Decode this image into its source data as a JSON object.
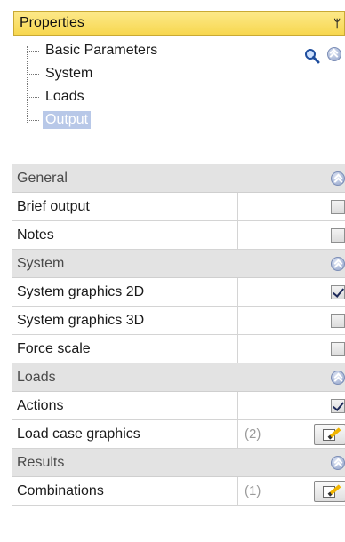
{
  "panel": {
    "title": "Properties"
  },
  "tree": {
    "items": [
      {
        "label": "Basic Parameters",
        "selected": false
      },
      {
        "label": "System",
        "selected": false
      },
      {
        "label": "Loads",
        "selected": false
      },
      {
        "label": "Output",
        "selected": true
      }
    ]
  },
  "icons": {
    "search": "search-icon",
    "collapse": "double-chevron-up-icon",
    "pin": "pin-icon",
    "edit": "edit-icon"
  },
  "sections": [
    {
      "title": "General",
      "rows": [
        {
          "label": "Brief output",
          "control": "checkbox",
          "checked": false
        },
        {
          "label": "Notes",
          "control": "checkbox",
          "checked": false
        }
      ]
    },
    {
      "title": "System",
      "rows": [
        {
          "label": "System graphics 2D",
          "control": "checkbox",
          "checked": true
        },
        {
          "label": "System graphics 3D",
          "control": "checkbox",
          "checked": false
        },
        {
          "label": "Force scale",
          "control": "checkbox",
          "checked": false
        }
      ]
    },
    {
      "title": "Loads",
      "rows": [
        {
          "label": "Actions",
          "control": "checkbox",
          "checked": true
        },
        {
          "label": "Load case graphics",
          "control": "button",
          "count": "(2)"
        }
      ]
    },
    {
      "title": "Results",
      "rows": [
        {
          "label": "Combinations",
          "control": "button",
          "count": "(1)"
        }
      ]
    }
  ],
  "colors": {
    "header": "#f7d74f",
    "section": "#e3e3e3",
    "selection": "#b8c8e8"
  }
}
